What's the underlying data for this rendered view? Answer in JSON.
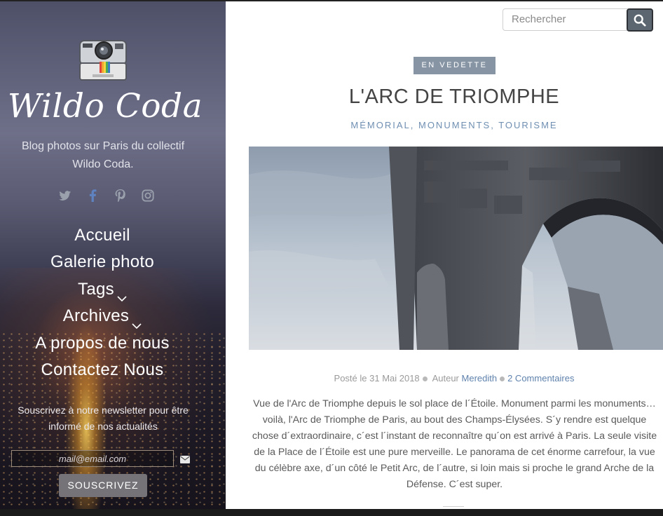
{
  "sidebar": {
    "logo_icon": "instant-camera-icon",
    "blog_title": "Wildo Coda",
    "tagline": "Blog photos sur Paris du collectif Wildo Coda.",
    "social_icons": [
      "twitter-icon",
      "facebook-icon",
      "pinterest-icon",
      "instagram-icon"
    ],
    "nav": [
      {
        "label": "Accueil",
        "has_dropdown": false
      },
      {
        "label": "Galerie photo",
        "has_dropdown": false
      },
      {
        "label": "Tags",
        "has_dropdown": true
      },
      {
        "label": "Archives",
        "has_dropdown": true
      },
      {
        "label": "A propos de nous",
        "has_dropdown": false
      },
      {
        "label": "Contactez Nous",
        "has_dropdown": false
      }
    ],
    "newsletter_text": "Souscrivez à notre newsletter pour être informé de nos actualités",
    "email_placeholder": "mail@email.com",
    "email_icon": "envelope-icon",
    "subscribe_label": "SOUSCRIVEZ"
  },
  "search": {
    "placeholder": "Rechercher",
    "button_icon": "search-icon"
  },
  "post": {
    "badge": "EN VEDETTE",
    "title": "L'ARC DE TRIOMPHE",
    "categories": "MÉMORIAL, MONUMENTS, TOURISME",
    "image_subject": "Arc de Triomphe",
    "meta": {
      "posted": "Posté le 31 Mai 2018",
      "author_prefix": "Auteur",
      "author": "Meredith",
      "comments": "2 Commentaires"
    },
    "excerpt": "Vue de l'Arc de Triomphe depuis le sol place de l´Étoile. Monument parmi les monuments… voilà, l'Arc de Triomphe de Paris, au bout des Champs-Élysées. S´y rendre est quelque chose d´extraordinaire, c´est l´instant de reconnaître qu´on est arrivé à Paris. La seule visite de la Place de l´Étoile est une pure merveille. Le panorama de cet énorme carrefour, la vue du célèbre axe, d´un côté le Petit Arc, de l´autre, si loin mais si proche le grand Arche de la Défense. C´est super."
  },
  "colors": {
    "accent_link": "#5f82ad",
    "badge_bg": "#8694a4",
    "button_bg": "#757378"
  }
}
